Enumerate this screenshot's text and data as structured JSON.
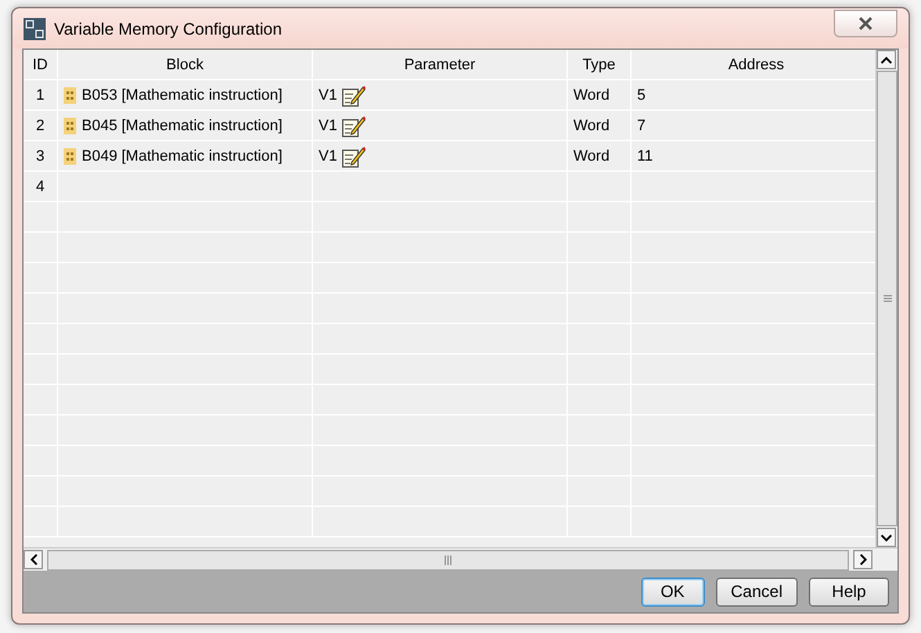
{
  "window": {
    "title": "Variable Memory Configuration"
  },
  "table": {
    "columns": [
      "ID",
      "Block",
      "Parameter",
      "Type",
      "Address"
    ],
    "rows": [
      {
        "id": "1",
        "block": "B053 [Mathematic instruction]",
        "parameter": "V1",
        "type": "Word",
        "address": "5"
      },
      {
        "id": "2",
        "block": "B045 [Mathematic instruction]",
        "parameter": "V1",
        "type": "Word",
        "address": "7"
      },
      {
        "id": "3",
        "block": "B049 [Mathematic instruction]",
        "parameter": "V1",
        "type": "Word",
        "address": "11"
      },
      {
        "id": "4"
      }
    ]
  },
  "buttons": [
    {
      "label": "OK",
      "kind": "default"
    },
    {
      "label": "Cancel",
      "kind": "normal"
    },
    {
      "label": "Help",
      "kind": "normal"
    }
  ]
}
